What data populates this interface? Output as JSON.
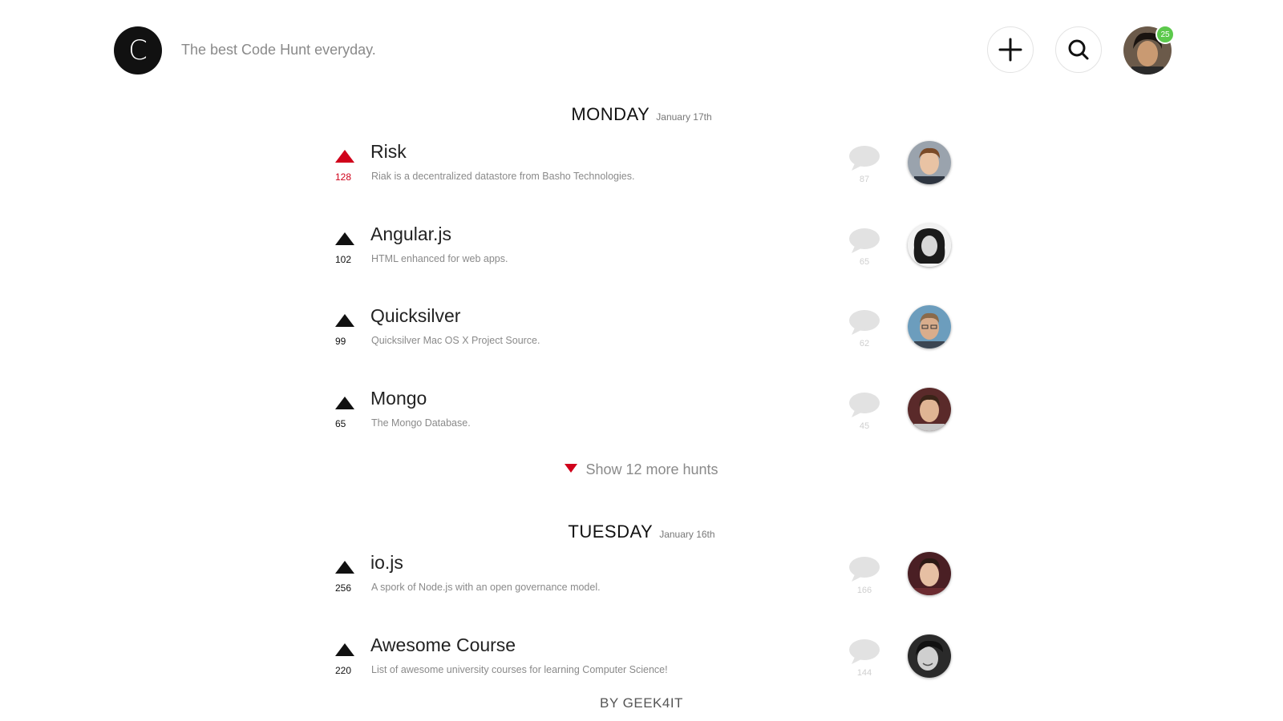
{
  "header": {
    "logo_letter": "C",
    "tagline": "The best Code Hunt everyday.",
    "add_icon": "plus-icon",
    "search_icon": "search-icon",
    "notification_count": "25"
  },
  "days": [
    {
      "name": "MONDAY",
      "date": "January 17th",
      "hunts": [
        {
          "votes": "128",
          "title": "Risk",
          "description": "Riak is a decentralized datastore from Basho Technologies.",
          "comments": "87",
          "hot": true
        },
        {
          "votes": "102",
          "title": "Angular.js",
          "description": "HTML enhanced for web apps.",
          "comments": "65",
          "hot": false
        },
        {
          "votes": "99",
          "title": "Quicksilver",
          "description": "Quicksilver Mac OS X Project Source.",
          "comments": "62",
          "hot": false
        },
        {
          "votes": "65",
          "title": "Mongo",
          "description": "The Mongo Database.",
          "comments": "45",
          "hot": false
        }
      ],
      "show_more": "Show 12 more hunts"
    },
    {
      "name": "TUESDAY",
      "date": "January 16th",
      "hunts": [
        {
          "votes": "256",
          "title": "io.js",
          "description": "A spork of Node.js with an open governance model.",
          "comments": "166",
          "hot": false
        },
        {
          "votes": "220",
          "title": "Awesome Course",
          "description": "List of awesome university courses for learning Computer Science!",
          "comments": "144",
          "hot": false
        }
      ]
    }
  ],
  "footer": "BY GEEK4IT",
  "colors": {
    "accent": "#d0021b",
    "badge": "#5cc94c",
    "muted": "#8a8a8a"
  }
}
